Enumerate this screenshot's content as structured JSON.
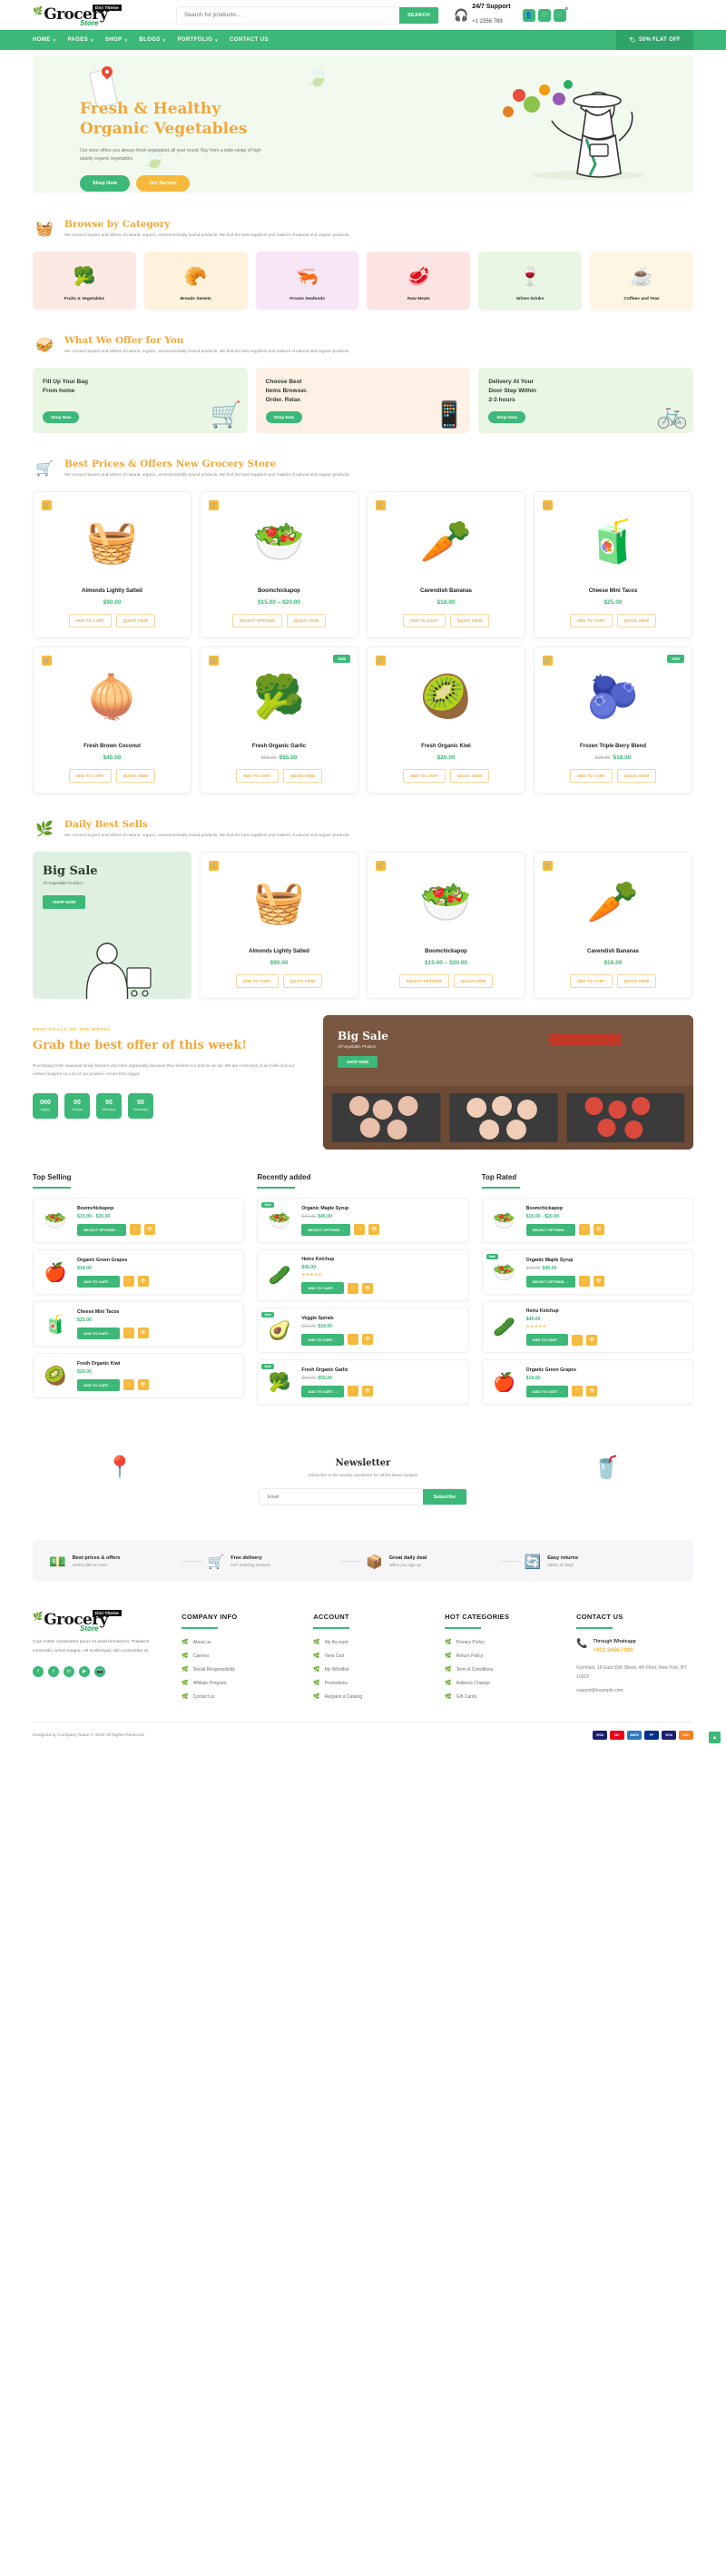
{
  "header": {
    "logo_main": "Grocery",
    "logo_sub": "Store",
    "logo_badge": "Divi Theme",
    "search_placeholder": "Search for products...",
    "search_value": "",
    "search_button": "SEARCH",
    "support_title": "24/7 Support",
    "support_phone": "+1 2356 789",
    "cart_count": "0",
    "icons": {
      "headset": "headset-icon",
      "user": "user-icon",
      "wishlist": "heart-icon",
      "cart": "cart-icon"
    }
  },
  "nav": {
    "items": [
      {
        "label": "HOME",
        "caret": true
      },
      {
        "label": "PAGES",
        "caret": true
      },
      {
        "label": "SHOP",
        "caret": true
      },
      {
        "label": "BLOGS",
        "caret": true
      },
      {
        "label": "PORTFOLIO",
        "caret": true
      },
      {
        "label": "CONTACT US",
        "caret": false
      }
    ],
    "offer_label": "50% FLAT OFF"
  },
  "hero": {
    "title_line1": "Fresh & Healthy",
    "title_line2": "Organic Vegetables",
    "paragraph": "Our store offers you always fresh vegetables all year round. Buy from a wide range of high quality organic vegetables.",
    "btn_primary": "Shop Now",
    "btn_secondary": "Our Service",
    "accent": "#f0a73c"
  },
  "category_section": {
    "title": "Browse by Category",
    "subtitle": "We connect buyers and sellers of natural, organic, environmentally sound products. We find the best suppliers and makers of natural and organic products.",
    "items": [
      {
        "name": "Fruits & Vegetables",
        "emoji": "🥦",
        "bg": "#fde9e4"
      },
      {
        "name": "Breads Sweets",
        "emoji": "🥐",
        "bg": "#fdf2dc"
      },
      {
        "name": "Frozen Seafoods",
        "emoji": "🦐",
        "bg": "#f6e6f6"
      },
      {
        "name": "Raw Meats",
        "emoji": "🥩",
        "bg": "#fde4e4"
      },
      {
        "name": "Wines Drinks",
        "emoji": "🍷",
        "bg": "#eaf6e4"
      },
      {
        "name": "Coffees and Teas",
        "emoji": "☕",
        "bg": "#fdf6e2"
      }
    ]
  },
  "offer_section": {
    "title": "What We Offer for You",
    "subtitle": "We connect buyers and sellers of natural, organic, environmentally sound products. We find the best suppliers and makers of natural and organic products.",
    "cards": [
      {
        "title": "Fill Up Your Bag From home",
        "button": "Shop Now",
        "bg": "#eaf6e4",
        "emoji": "🛒"
      },
      {
        "title": "Choose Best Items Browser. Order. Relax",
        "button": "Shop Now",
        "bg": "#fdf0e4",
        "emoji": "📱"
      },
      {
        "title": "Delivery At Your Door Step Within 2-3 hours",
        "button": "Shop Now",
        "bg": "#eaf6e4",
        "emoji": "🚲"
      }
    ]
  },
  "best_prices": {
    "title": "Best Prices & Offers New Grocery Store",
    "subtitle": "We connect buyers and sellers of natural, organic, environmentally sound products. We find the best suppliers and makers of natural and organic products.",
    "products": [
      {
        "name": "Almonds Lightly Salted",
        "price": "$90.00",
        "old_price": "",
        "emoji": "🧺",
        "sale": false,
        "actions": [
          "ADD TO CART",
          "QUICK VIEW"
        ]
      },
      {
        "name": "Boomchickapop",
        "price": "$15.00 – $20.00",
        "old_price": "",
        "emoji": "🥗",
        "sale": false,
        "actions": [
          "SELECT OPTIONS",
          "QUICK VIEW"
        ]
      },
      {
        "name": "Cavendish Bananas",
        "price": "$18.00",
        "old_price": "",
        "emoji": "🥕",
        "sale": false,
        "actions": [
          "ADD TO CART",
          "QUICK VIEW"
        ]
      },
      {
        "name": "Cheese Mini Tacos",
        "price": "$25.00",
        "old_price": "",
        "emoji": "🧃",
        "sale": false,
        "actions": [
          "ADD TO CART",
          "QUICK VIEW"
        ]
      },
      {
        "name": "Fresh Brown Coconut",
        "price": "$45.00",
        "old_price": "",
        "emoji": "🧅",
        "sale": false,
        "actions": [
          "ADD TO CART",
          "QUICK VIEW"
        ]
      },
      {
        "name": "Fresh Organic Garlic",
        "price": "$55.00",
        "old_price": "$65.00",
        "emoji": "🥦",
        "sale": true,
        "actions": [
          "ADD TO CART",
          "QUICK VIEW"
        ]
      },
      {
        "name": "Fresh Organic Kiwi",
        "price": "$20.00",
        "old_price": "",
        "emoji": "🥝",
        "sale": false,
        "actions": [
          "ADD TO CART",
          "QUICK VIEW"
        ]
      },
      {
        "name": "Frozen Triple Berry Blend",
        "price": "$18.00",
        "old_price": "$25.00",
        "emoji": "🫐",
        "sale": true,
        "actions": [
          "ADD TO CART",
          "QUICK VIEW"
        ]
      }
    ]
  },
  "daily_best": {
    "title": "Daily Best Sells",
    "subtitle": "We connect buyers and sellers of natural, organic, environmentally sound products. We find the best suppliers and makers of natural and organic products.",
    "promo": {
      "title": "Big Sale",
      "subtitle": "All Vegetable Product",
      "button": "SHOP NOW"
    },
    "products": [
      {
        "name": "Almonds Lightly Salted",
        "price": "$90.00",
        "emoji": "🧺",
        "actions": [
          "ADD TO CART",
          "QUICK VIEW"
        ]
      },
      {
        "name": "Boomchickapop",
        "price": "$15.00 – $20.00",
        "emoji": "🥗",
        "actions": [
          "SELECT OPTIONS",
          "QUICK VIEW"
        ]
      },
      {
        "name": "Cavendish Bananas",
        "price": "$18.00",
        "emoji": "🥕",
        "actions": [
          "ADD TO CART",
          "QUICK VIEW"
        ]
      }
    ]
  },
  "deal": {
    "kicker": "BEST DEALS OF THE WEEK!",
    "title": "Grab the best offer of this week!",
    "paragraph": "Purchasing fresh seasonal family farmers who farm organically because they believe in it and so we do. We are conscious of air miles and our carbon footprint so a lot of our produce comes from Egypt.",
    "countdown": [
      {
        "value": "000",
        "label": "Day(s)"
      },
      {
        "value": "00",
        "label": "Hour(s)"
      },
      {
        "value": "00",
        "label": "Minute(s)"
      },
      {
        "value": "00",
        "label": "Second(s)"
      }
    ],
    "banner": {
      "title": "Big Sale",
      "subtitle": "All Vegetable Product",
      "button": "SHOP NOW"
    }
  },
  "lists": [
    {
      "title": "Top Selling",
      "items": [
        {
          "name": "Boomchickapop",
          "price": "$15.00 - $20.00",
          "old_price": "",
          "emoji": "🥗",
          "cta": "SELECT OPTIONS",
          "sale": false,
          "stars": ""
        },
        {
          "name": "Organic Green Grapes",
          "price": "$18.00",
          "old_price": "",
          "emoji": "🍎",
          "cta": "ADD TO CART",
          "sale": false,
          "stars": ""
        },
        {
          "name": "Cheese Mini Tacos",
          "price": "$25.00",
          "old_price": "",
          "emoji": "🧃",
          "cta": "ADD TO CART",
          "sale": false,
          "stars": ""
        },
        {
          "name": "Fresh Organic Kiwi",
          "price": "$20.00",
          "old_price": "",
          "emoji": "🥝",
          "cta": "ADD TO CART",
          "sale": false,
          "stars": ""
        }
      ]
    },
    {
      "title": "Recently added",
      "items": [
        {
          "name": "Organic Maple Syrup",
          "price": "$45.00",
          "old_price": "$42.00",
          "emoji": "🥗",
          "cta": "SELECT OPTIONS",
          "sale": true,
          "stars": ""
        },
        {
          "name": "Heinz Ketchup",
          "price": "$45.00",
          "old_price": "",
          "emoji": "🥒",
          "cta": "ADD TO CART",
          "sale": false,
          "stars": "★★★★★"
        },
        {
          "name": "Veggie Spirals",
          "price": "$18.00",
          "old_price": "$26.00",
          "emoji": "🥑",
          "cta": "ADD TO CART",
          "sale": true,
          "stars": ""
        },
        {
          "name": "Fresh Organic Garlic",
          "price": "$55.00",
          "old_price": "$65.00",
          "emoji": "🥦",
          "cta": "ADD TO CART",
          "sale": true,
          "stars": ""
        }
      ]
    },
    {
      "title": "Top Rated",
      "items": [
        {
          "name": "Boomchickapop",
          "price": "$15.00 - $20.00",
          "old_price": "",
          "emoji": "🥗",
          "cta": "SELECT OPTIONS",
          "sale": false,
          "stars": ""
        },
        {
          "name": "Organic Maple Syrup",
          "price": "$45.00",
          "old_price": "$42.00",
          "emoji": "🥗",
          "cta": "SELECT OPTIONS",
          "sale": true,
          "stars": ""
        },
        {
          "name": "Heinz Ketchup",
          "price": "$45.00",
          "old_price": "",
          "emoji": "🥒",
          "cta": "ADD TO CART",
          "sale": false,
          "stars": "★★★★★"
        },
        {
          "name": "Organic Green Grapes",
          "price": "$18.00",
          "old_price": "",
          "emoji": "🍎",
          "cta": "ADD TO CART",
          "sale": false,
          "stars": ""
        }
      ]
    }
  ],
  "newsletter": {
    "title": "Newsletter",
    "subtitle": "Subscribe to the weekly newsletter for all the latest updates",
    "placeholder": "Email",
    "value": "",
    "button": "Subscribe"
  },
  "features": [
    {
      "title": "Best prices & offers",
      "sub": "Orders $50 or more",
      "emoji": "💵"
    },
    {
      "title": "Free delivery",
      "sub": "24/7 amazing services",
      "emoji": "🛒"
    },
    {
      "title": "Great daily deal",
      "sub": "When you sign up",
      "emoji": "📦"
    },
    {
      "title": "Easy returns",
      "sub": "Within 30 days",
      "emoji": "🔄"
    }
  ],
  "footer": {
    "description": "Cras mattis consectetur purus sit amet fermentum. Praesent commodo cursus magna, vel scelerisque nisl consectetur at.",
    "socials": [
      "f",
      "t",
      "in",
      "▶",
      "📷"
    ],
    "columns": [
      {
        "title": "COMPANY INFO",
        "links": [
          "About us",
          "Careers",
          "Social Responsibility",
          "Affiliate Program",
          "Contact us"
        ]
      },
      {
        "title": "ACCOUNT",
        "links": [
          "My Account",
          "View Cart",
          "My Whistlist",
          "Promotions",
          "Request a Catalog"
        ]
      },
      {
        "title": "HOT CATEGORIES",
        "links": [
          "Privacy Policy",
          "Return Policy",
          "Term & Conditions",
          "Address Change",
          "Gift Cards"
        ]
      }
    ],
    "contact": {
      "title": "CONTACT US",
      "label": "Through Whatsapp",
      "phone": "+012-3456-7890",
      "address": "GymVast, 18 East 50th Street, 4th Floor, New York, NY 10022",
      "email": "support@example.com"
    },
    "copyright_prefix": "Designed by Company Name © 2024 All Rights Reserved",
    "payments": [
      {
        "label": "VISA",
        "bg": "#1a1f71"
      },
      {
        "label": "MC",
        "bg": "#eb001b"
      },
      {
        "label": "AMEX",
        "bg": "#2e77bc"
      },
      {
        "label": "PP",
        "bg": "#003087"
      },
      {
        "label": "VISA",
        "bg": "#1a1f71"
      },
      {
        "label": "DSC",
        "bg": "#f68121"
      }
    ]
  }
}
